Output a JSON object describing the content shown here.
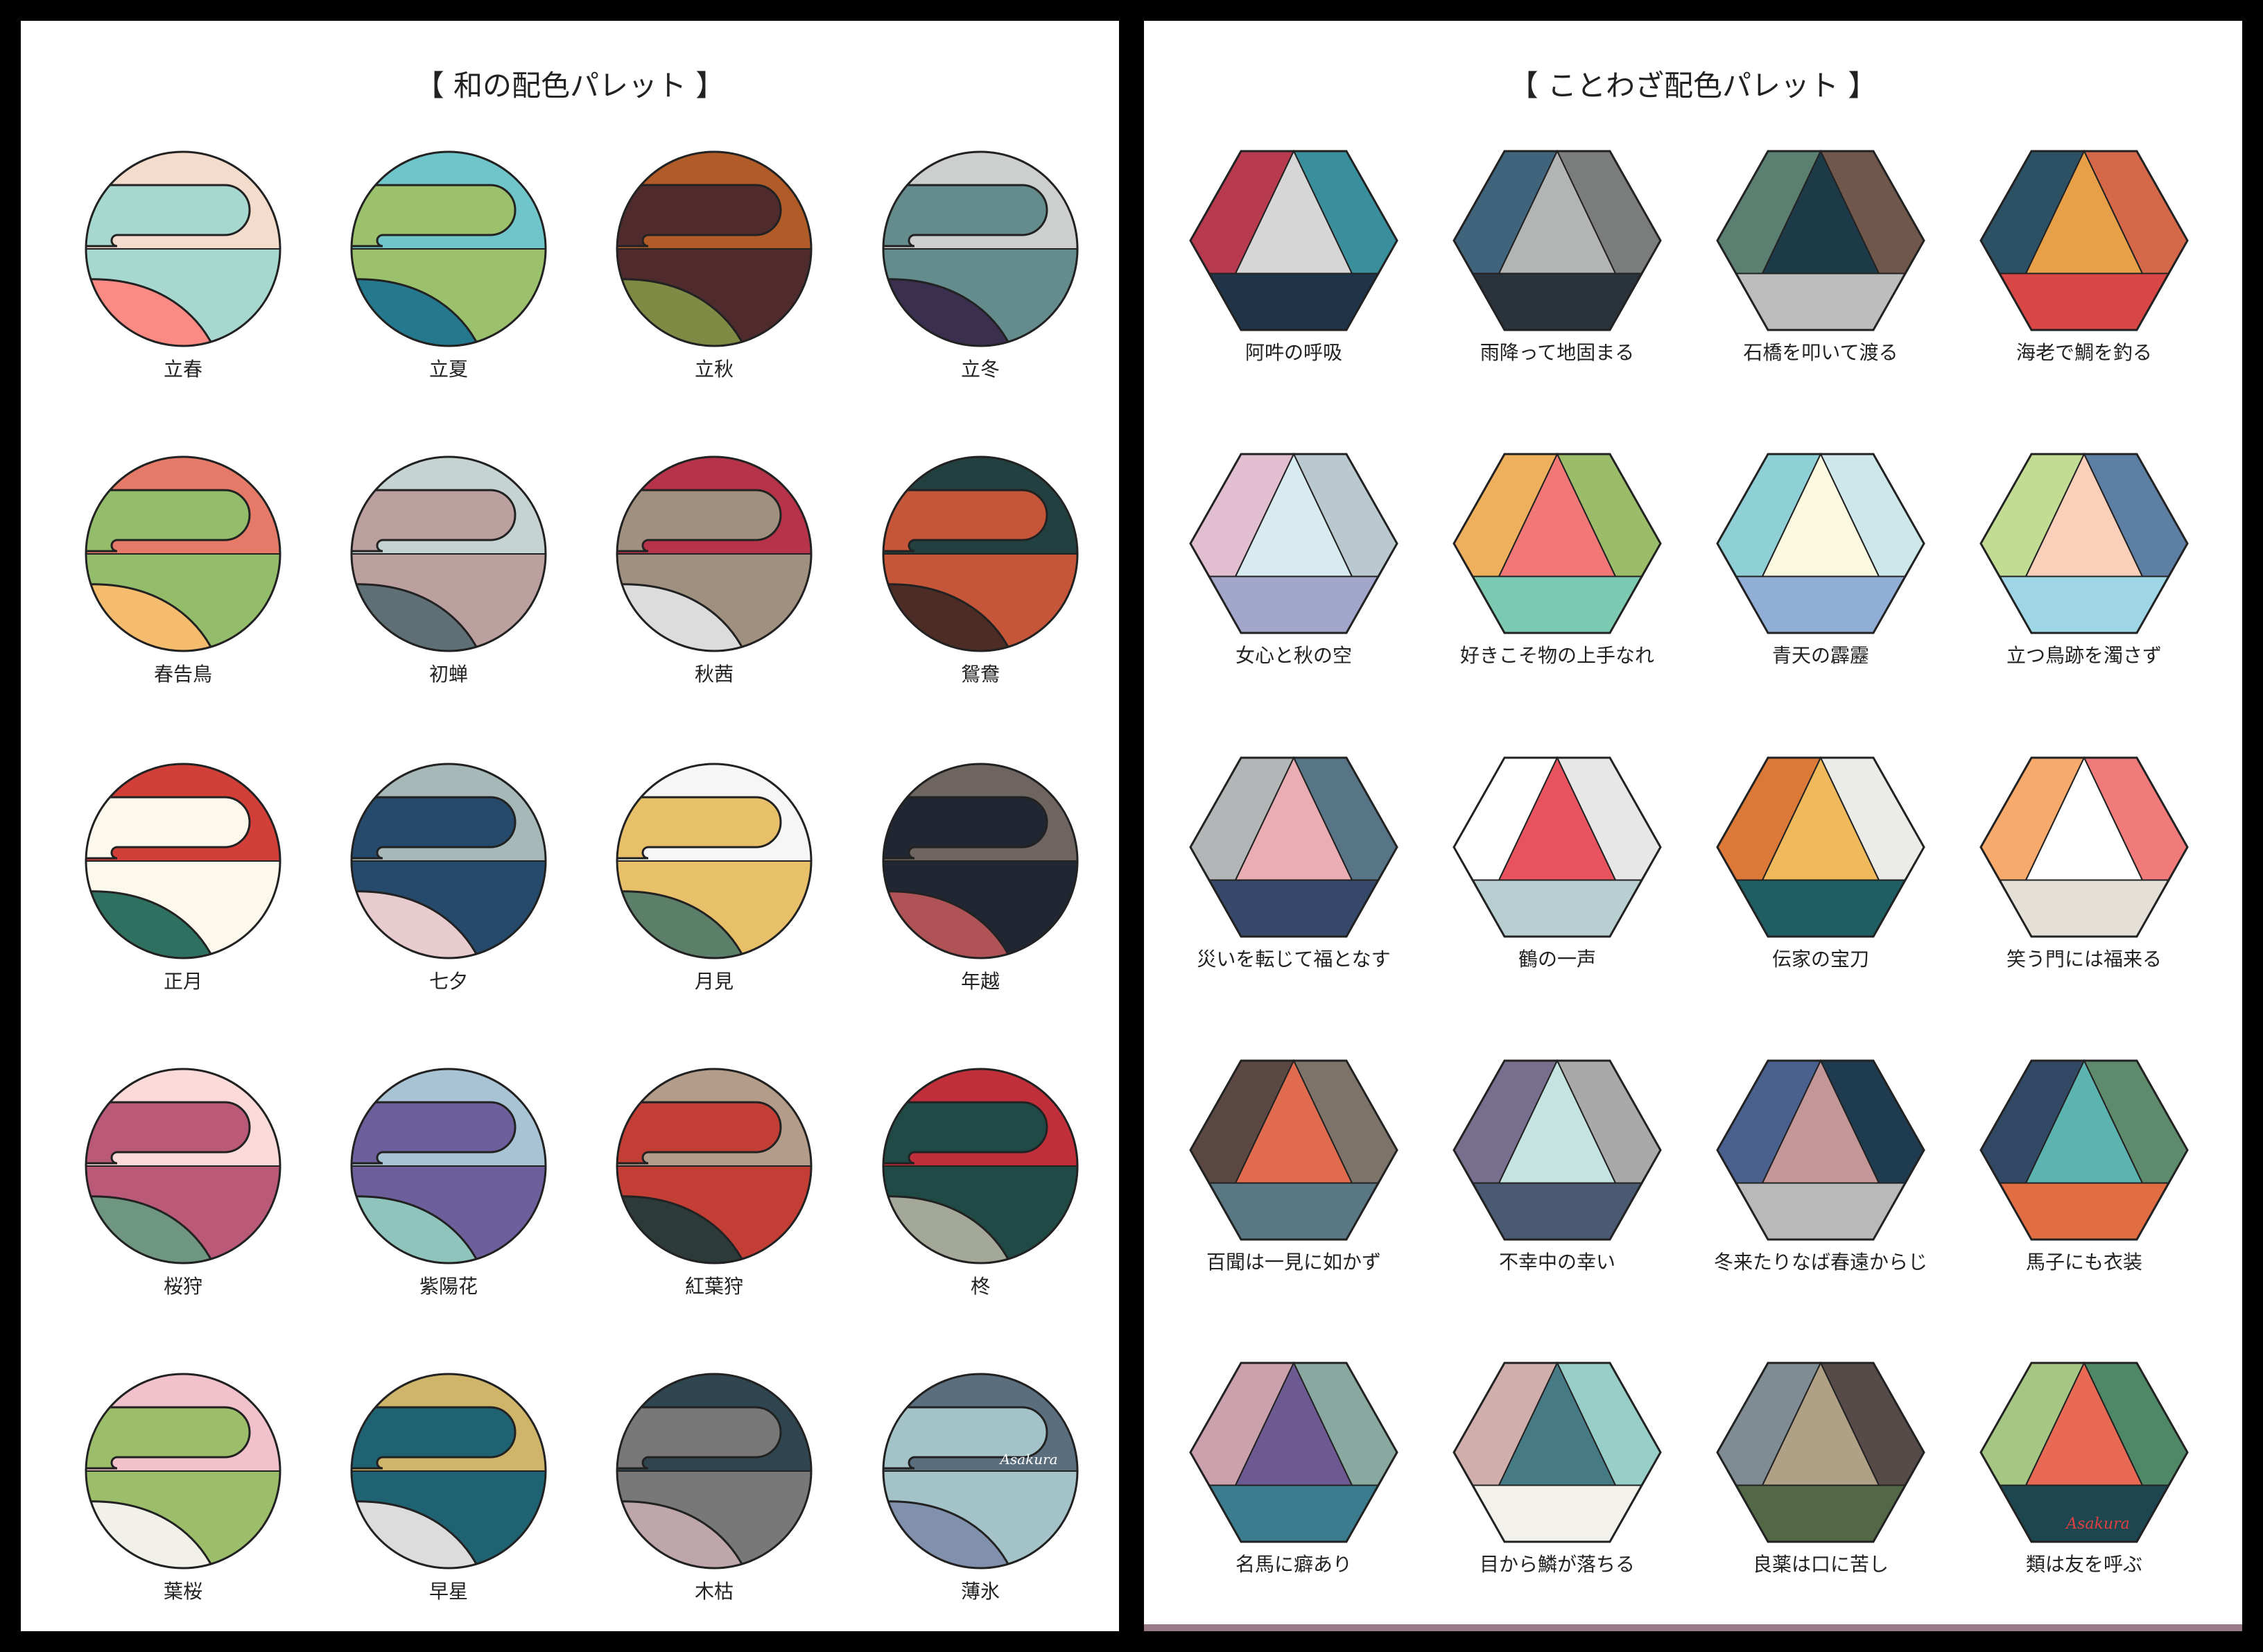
{
  "wa_palette": {
    "title": "【 和の配色パレット 】",
    "items": [
      {
        "label": "立春",
        "colors": [
          "#f3dccc",
          "#a7d8cf",
          "#fb8a85",
          "#f3dccc"
        ]
      },
      {
        "label": "立夏",
        "colors": [
          "#6fc5c9",
          "#9cc16c",
          "#24798f",
          "#9cc16c"
        ]
      },
      {
        "label": "立秋",
        "colors": [
          "#b05b28",
          "#4f2b2e",
          "#7f8b45",
          "#4f2b2e"
        ]
      },
      {
        "label": "立冬",
        "colors": [
          "#cdcfcf",
          "#648c8c",
          "#3a2f4f",
          "#648c8c"
        ]
      },
      {
        "label": "春告鳥",
        "colors": [
          "#e57a68",
          "#94bd6b",
          "#f6bc6e",
          "#94bd6b"
        ]
      },
      {
        "label": "初蝉",
        "colors": [
          "#c5d3d3",
          "#bc9f9f",
          "#5f6f76",
          "#bc9f9f"
        ]
      },
      {
        "label": "秋茜",
        "colors": [
          "#b7334a",
          "#a0907f",
          "#dcdcdc",
          "#a0907f"
        ]
      },
      {
        "label": "鴛鴦",
        "colors": [
          "#22403f",
          "#c65639",
          "#4e2c26",
          "#c65639"
        ]
      },
      {
        "label": "正月",
        "colors": [
          "#d23e38",
          "#fdf8ec",
          "#2f7160",
          "#fdf8ec"
        ]
      },
      {
        "label": "七夕",
        "colors": [
          "#a7b8b8",
          "#254a6b",
          "#e8cbcf",
          "#254a6b"
        ]
      },
      {
        "label": "月見",
        "colors": [
          "#f6f6f6",
          "#e8c06a",
          "#5b7f68",
          "#e8c06a"
        ]
      },
      {
        "label": "年越",
        "colors": [
          "#6f6560",
          "#202733",
          "#b05356",
          "#202733"
        ]
      },
      {
        "label": "桜狩",
        "colors": [
          "#fcdada",
          "#bb5a78",
          "#6e9680",
          "#bb5a78"
        ]
      },
      {
        "label": "紫陽花",
        "colors": [
          "#a8c3d3",
          "#6d5f9c",
          "#8ec4bb",
          "#6d5f9c"
        ]
      },
      {
        "label": "紅葉狩",
        "colors": [
          "#b39d8a",
          "#c33f35",
          "#2c3a3a",
          "#c33f35"
        ]
      },
      {
        "label": "柊",
        "colors": [
          "#c02f3a",
          "#1f4a46",
          "#a4a898",
          "#1f4a46"
        ]
      },
      {
        "label": "葉桜",
        "colors": [
          "#f1c2cc",
          "#9cbe6b",
          "#f1f1ea",
          "#9cbe6b"
        ]
      },
      {
        "label": "早星",
        "colors": [
          "#cfb56a",
          "#1f6373",
          "#dcdcdc",
          "#1f6373"
        ]
      },
      {
        "label": "木枯",
        "colors": [
          "#2f4550",
          "#787878",
          "#bfa6aa",
          "#787878"
        ]
      },
      {
        "label": "薄氷",
        "colors": [
          "#5a6e7d",
          "#a3c3c8",
          "#8190ad",
          "#a3c3c8"
        ]
      }
    ],
    "signature": "Asakura"
  },
  "kotowaza_palette": {
    "title": "【 ことわざ配色パレット 】",
    "items": [
      {
        "label": "阿吽の呼吸",
        "colors": [
          "#b83a4f",
          "#3a8f9c",
          "#1f3448",
          "#d6d6d6"
        ]
      },
      {
        "label": "雨降って地固まる",
        "colors": [
          "#40647c",
          "#7a7d7c",
          "#2a323c",
          "#b3b5b5"
        ]
      },
      {
        "label": "石橋を叩いて渡る",
        "colors": [
          "#5b8071",
          "#6f574b",
          "#bdbdbd",
          "#1d3a48"
        ]
      },
      {
        "label": "海老で鯛を釣る",
        "colors": [
          "#2c5064",
          "#d6684a",
          "#d94646",
          "#e8a048"
        ]
      },
      {
        "label": "女心と秋の空",
        "colors": [
          "#e2bfd0",
          "#b9c9cf",
          "#a3a6cb",
          "#d8ebf1"
        ]
      },
      {
        "label": "好きこそ物の上手なれ",
        "colors": [
          "#eeb05c",
          "#9bbc68",
          "#7ccab1",
          "#f27878"
        ]
      },
      {
        "label": "青天の霹靂",
        "colors": [
          "#8fd0d6",
          "#cde7ea",
          "#91aed6",
          "#fbf9e0"
        ]
      },
      {
        "label": "立つ鳥跡を濁さず",
        "colors": [
          "#c3dc93",
          "#5d7fa3",
          "#9fd6e6",
          "#fbd0bb"
        ]
      },
      {
        "label": "災いを転じて福となす",
        "colors": [
          "#b3b6b7",
          "#577586",
          "#36496b",
          "#e9adb3"
        ]
      },
      {
        "label": "鶴の一声",
        "colors": [
          "#ffffff",
          "#e7e7e7",
          "#b8cfd1",
          "#e8535f"
        ]
      },
      {
        "label": "伝家の宝刀",
        "colors": [
          "#dd7938",
          "#ebebe8",
          "#1f5e62",
          "#f0b95c"
        ]
      },
      {
        "label": "笑う門には福来る",
        "colors": [
          "#f8a96c",
          "#f07b7a",
          "#e4e0d8",
          "#ffffff"
        ]
      },
      {
        "label": "百聞は一見に如かず",
        "colors": [
          "#5b4842",
          "#7d7369",
          "#5a7884",
          "#e06b4e"
        ]
      },
      {
        "label": "不幸中の幸い",
        "colors": [
          "#776f8d",
          "#a9a9a9",
          "#4b5a73",
          "#c5e3e1"
        ]
      },
      {
        "label": "冬来たりなば春遠からじ",
        "colors": [
          "#4a6190",
          "#1f3b50",
          "#b9b9b9",
          "#c39697"
        ]
      },
      {
        "label": "馬子にも衣装",
        "colors": [
          "#324965",
          "#5f8b6d",
          "#e16d43",
          "#5bb4b0"
        ]
      },
      {
        "label": "名馬に癖あり",
        "colors": [
          "#caa1ad",
          "#88a8a0",
          "#3b7d8f",
          "#6e5a92"
        ]
      },
      {
        "label": "目から鱗が落ちる",
        "colors": [
          "#cfaeac",
          "#98cec8",
          "#f2f1ec",
          "#467b86"
        ]
      },
      {
        "label": "良薬は口に苦し",
        "colors": [
          "#7f8c93",
          "#574b4a",
          "#536846",
          "#b0a086"
        ]
      },
      {
        "label": "類は友を呼ぶ",
        "colors": [
          "#a6c784",
          "#4f8866",
          "#1d4650",
          "#e86a55"
        ]
      }
    ],
    "signature": "Asakura"
  }
}
